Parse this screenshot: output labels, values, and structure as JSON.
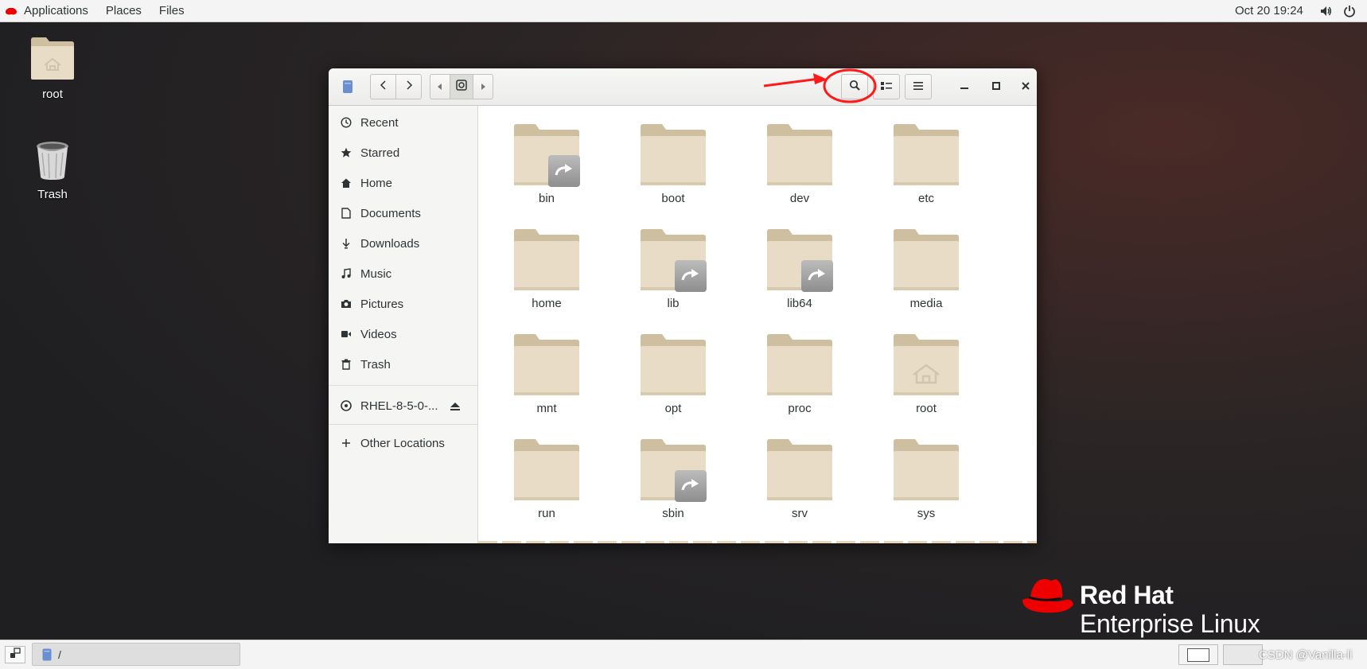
{
  "topbar": {
    "menus": [
      "Applications",
      "Places",
      "Files"
    ],
    "clock": "Oct 20  19:24",
    "icons": [
      "redhat-logo-icon",
      "volume-icon",
      "power-icon"
    ]
  },
  "desktop": {
    "icons": [
      {
        "label": "root",
        "icon": "home-folder-icon"
      },
      {
        "label": "Trash",
        "icon": "trash-icon"
      }
    ]
  },
  "window": {
    "headerbar": {
      "icons": [
        "files-app-icon",
        "back-icon",
        "forward-icon",
        "path-left-icon",
        "root-drive-icon",
        "path-right-icon",
        "search-icon",
        "list-view-icon",
        "menu-icon",
        "minimize-icon",
        "maximize-icon",
        "close-icon"
      ]
    },
    "sidebar": {
      "items": [
        {
          "label": "Recent",
          "icon": "clock-icon"
        },
        {
          "label": "Starred",
          "icon": "star-icon"
        },
        {
          "label": "Home",
          "icon": "home-icon"
        },
        {
          "label": "Documents",
          "icon": "document-icon"
        },
        {
          "label": "Downloads",
          "icon": "download-icon"
        },
        {
          "label": "Music",
          "icon": "music-icon"
        },
        {
          "label": "Pictures",
          "icon": "camera-icon"
        },
        {
          "label": "Videos",
          "icon": "video-icon"
        },
        {
          "label": "Trash",
          "icon": "trash-icon"
        }
      ],
      "device": {
        "label": "RHEL-8-5-0-...",
        "icon": "disc-icon",
        "eject_icon": "eject-icon"
      },
      "other": {
        "label": "Other Locations",
        "icon": "plus-icon"
      }
    },
    "files": [
      {
        "name": "bin",
        "link": true,
        "home": false
      },
      {
        "name": "boot",
        "link": false,
        "home": false
      },
      {
        "name": "dev",
        "link": false,
        "home": false
      },
      {
        "name": "etc",
        "link": false,
        "home": false
      },
      {
        "name": "home",
        "link": false,
        "home": false
      },
      {
        "name": "lib",
        "link": true,
        "home": false
      },
      {
        "name": "lib64",
        "link": true,
        "home": false
      },
      {
        "name": "media",
        "link": false,
        "home": false
      },
      {
        "name": "mnt",
        "link": false,
        "home": false
      },
      {
        "name": "opt",
        "link": false,
        "home": false
      },
      {
        "name": "proc",
        "link": false,
        "home": false
      },
      {
        "name": "root",
        "link": false,
        "home": true
      },
      {
        "name": "run",
        "link": false,
        "home": false
      },
      {
        "name": "sbin",
        "link": true,
        "home": false
      },
      {
        "name": "srv",
        "link": false,
        "home": false
      },
      {
        "name": "sys",
        "link": false,
        "home": false
      }
    ]
  },
  "branding": {
    "line1": "Red Hat",
    "line2": "Enterprise Linux",
    "color": "#ee0000"
  },
  "taskbar": {
    "window_title": "/",
    "workspaces": 2
  },
  "watermark": "CSDN @Vanilla-li",
  "colors": {
    "folder": "#e8dcc7",
    "folder_tab": "#cdbf9f",
    "annotation": "#ff1a1a"
  }
}
